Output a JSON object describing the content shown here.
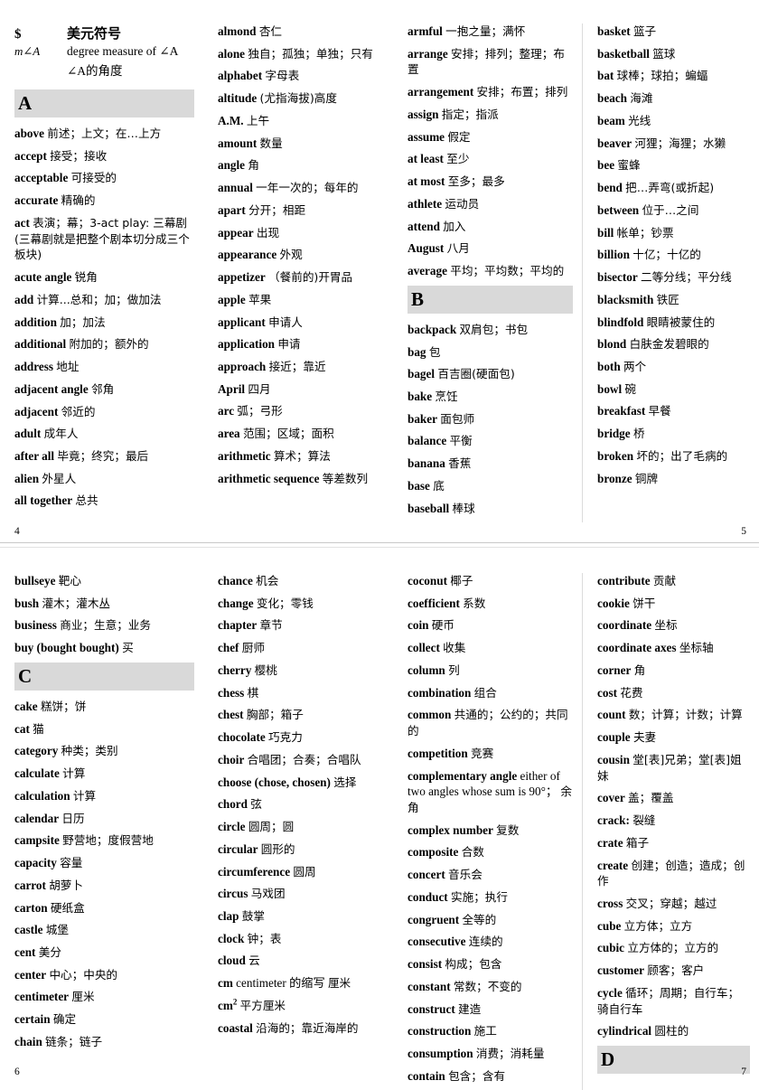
{
  "document": {
    "title": "English-Chinese Math Glossary",
    "header_bar_color": "#d9d9d9",
    "background_color": "#ffffff"
  },
  "symbol_block": {
    "rows": [
      {
        "key": "$",
        "value_cn": "美元符号"
      },
      {
        "key": "m∠A",
        "value_en": "degree measure of ∠A",
        "value_cn": "∠A的角度"
      }
    ]
  },
  "pages": [
    {
      "page_number_left": "4",
      "page_number_right": "5",
      "columns": [
        {
          "name": "column-1",
          "has_symbol_block": true,
          "letter_header": "A",
          "entries": [
            {
              "term": "above",
              "def": "前述；上文；在…上方"
            },
            {
              "term": "accept",
              "def": "接受；接收"
            },
            {
              "term": "acceptable",
              "def": "可接受的"
            },
            {
              "term": "accurate",
              "def": "精确的"
            },
            {
              "term": "act",
              "def": "表演；幕；3-act play: 三幕剧(三幕剧就是把整个剧本切分成三个板块)"
            },
            {
              "term": "acute angle",
              "def": "锐角"
            },
            {
              "term": "add",
              "def": "计算...总和；加；做加法"
            },
            {
              "term": "addition",
              "def": "加；加法"
            },
            {
              "term": "additional",
              "def": "附加的；额外的"
            },
            {
              "term": "address",
              "def": "地址"
            },
            {
              "term": "adjacent angle",
              "def": "邻角"
            },
            {
              "term": "adjacent",
              "def": "邻近的"
            },
            {
              "term": "adult",
              "def": "成年人"
            },
            {
              "term": "after all",
              "def": "毕竟；终究；最后"
            },
            {
              "term": "alien",
              "def": "外星人"
            },
            {
              "term": "all together",
              "def": "总共"
            }
          ]
        },
        {
          "name": "column-2",
          "has_symbol_block": false,
          "letter_header": null,
          "entries": [
            {
              "term": "almond",
              "def": "杏仁"
            },
            {
              "term": "alone",
              "def": "独自；孤独；单独；只有"
            },
            {
              "term": "alphabet",
              "def": "字母表"
            },
            {
              "term": "altitude",
              "def": "(尤指海拔)高度"
            },
            {
              "term": "A.M.",
              "def": "上午"
            },
            {
              "term": "amount",
              "def": "数量"
            },
            {
              "term": "angle",
              "def": "角"
            },
            {
              "term": "annual",
              "def": "一年一次的；每年的"
            },
            {
              "term": "apart",
              "def": "分开；相距"
            },
            {
              "term": "appear",
              "def": "出现"
            },
            {
              "term": "appearance",
              "def": "外观"
            },
            {
              "term": "appetizer",
              "def": "（餐前的)开胃品"
            },
            {
              "term": "apple",
              "def": "苹果"
            },
            {
              "term": "applicant",
              "def": "申请人"
            },
            {
              "term": "application",
              "def": "申请"
            },
            {
              "term": "approach",
              "def": "接近；靠近"
            },
            {
              "term": "April",
              "def": "四月"
            },
            {
              "term": "arc",
              "def": "弧；弓形"
            },
            {
              "term": "area",
              "def": "范围；区域；面积"
            },
            {
              "term": "arithmetic",
              "def": "算术；算法"
            },
            {
              "term": "arithmetic sequence",
              "def": "等差数列"
            }
          ]
        },
        {
          "name": "column-3",
          "has_symbol_block": false,
          "letter_header": null,
          "entries": [
            {
              "term": "armful",
              "def": "一抱之量；满怀"
            },
            {
              "term": "arrange",
              "def": "安排；排列；整理；布置"
            },
            {
              "term": "arrangement",
              "def": "安排；布置；排列"
            },
            {
              "term": "assign",
              "def": "指定；指派"
            },
            {
              "term": "assume",
              "def": "假定"
            },
            {
              "term": "at least",
              "def": "至少"
            },
            {
              "term": "at most",
              "def": "至多；最多"
            },
            {
              "term": "athlete",
              "def": "运动员"
            },
            {
              "term": "attend",
              "def": "加入"
            },
            {
              "term": "August",
              "def": "八月"
            },
            {
              "term": "average",
              "def": "平均；平均数；平均的"
            }
          ],
          "letter_header_mid": "B",
          "entries_after": [
            {
              "term": "backpack",
              "def": "双肩包；书包"
            },
            {
              "term": "bag",
              "def": "包"
            },
            {
              "term": "bagel",
              "def": "百吉圈(硬面包)"
            },
            {
              "term": "bake",
              "def": "烹饪"
            },
            {
              "term": "baker",
              "def": "面包师"
            },
            {
              "term": "balance",
              "def": "平衡"
            },
            {
              "term": "banana",
              "def": "香蕉"
            },
            {
              "term": "base",
              "def": "底"
            },
            {
              "term": "baseball",
              "def": "棒球"
            }
          ]
        },
        {
          "name": "column-4",
          "has_symbol_block": false,
          "letter_header": null,
          "entries": [
            {
              "term": "basket",
              "def": "篮子"
            },
            {
              "term": "basketball",
              "def": "篮球"
            },
            {
              "term": "bat",
              "def": "球棒；球拍；蝙蝠"
            },
            {
              "term": "beach",
              "def": "海滩"
            },
            {
              "term": "beam",
              "def": "光线"
            },
            {
              "term": "beaver",
              "def": "河狸；海狸；水獭"
            },
            {
              "term": "bee",
              "def": "蜜蜂"
            },
            {
              "term": "bend",
              "def": "把…弄弯(或折起)"
            },
            {
              "term": "between",
              "def": "位于…之间"
            },
            {
              "term": "bill",
              "def": "帐单；钞票"
            },
            {
              "term": "billion",
              "def": "十亿；十亿的"
            },
            {
              "term": "bisector",
              "def": "二等分线；平分线"
            },
            {
              "term": "blacksmith",
              "def": "铁匠"
            },
            {
              "term": "blindfold",
              "def": "眼睛被蒙住的"
            },
            {
              "term": "blond",
              "def": "白肤金发碧眼的"
            },
            {
              "term": "both",
              "def": "两个"
            },
            {
              "term": "bowl",
              "def": "碗"
            },
            {
              "term": "breakfast",
              "def": "早餐"
            },
            {
              "term": "bridge",
              "def": "桥"
            },
            {
              "term": "broken",
              "def": "坏的；出了毛病的"
            },
            {
              "term": "bronze",
              "def": "铜牌"
            }
          ]
        }
      ]
    },
    {
      "page_number_left": "6",
      "page_number_right": "7",
      "columns": [
        {
          "name": "column-1",
          "has_symbol_block": false,
          "letter_header": null,
          "entries": [
            {
              "term": "bullseye",
              "def": "靶心"
            },
            {
              "term": "bush",
              "def": "灌木；灌木丛"
            },
            {
              "term": "business",
              "def": "商业；生意；业务"
            },
            {
              "term": "buy (bought bought)",
              "def": "买"
            }
          ],
          "letter_header_mid": "C",
          "entries_after": [
            {
              "term": "cake",
              "def": "糕饼；饼"
            },
            {
              "term": "cat",
              "def": "猫"
            },
            {
              "term": "category",
              "def": "种类；类别"
            },
            {
              "term": "calculate",
              "def": "计算"
            },
            {
              "term": "calculation",
              "def": "计算"
            },
            {
              "term": "calendar",
              "def": "日历"
            },
            {
              "term": "campsite",
              "def": "野营地；度假营地"
            },
            {
              "term": "capacity",
              "def": "容量"
            },
            {
              "term": "carrot",
              "def": "胡萝卜"
            },
            {
              "term": "carton",
              "def": "硬纸盒"
            },
            {
              "term": "castle",
              "def": "城堡"
            },
            {
              "term": "cent",
              "def": "美分"
            },
            {
              "term": "center",
              "def": "中心；中央的"
            },
            {
              "term": "centimeter",
              "def": "厘米"
            },
            {
              "term": "certain",
              "def": "确定"
            },
            {
              "term": "chain",
              "def": "链条；链子"
            }
          ]
        },
        {
          "name": "column-2",
          "has_symbol_block": false,
          "letter_header": null,
          "entries": [
            {
              "term": "chance",
              "def": "机会"
            },
            {
              "term": "change",
              "def": "变化；零钱"
            },
            {
              "term": "chapter",
              "def": "章节"
            },
            {
              "term": "chef",
              "def": "厨师"
            },
            {
              "term": "cherry",
              "def": "樱桃"
            },
            {
              "term": "chess",
              "def": "棋"
            },
            {
              "term": "chest",
              "def": "胸部；箱子"
            },
            {
              "term": "chocolate",
              "def": "巧克力"
            },
            {
              "term": "choir",
              "def": "合唱团；合奏；合唱队"
            },
            {
              "term": "choose (chose, chosen)",
              "def": "选择"
            },
            {
              "term": "chord",
              "def": "弦"
            },
            {
              "term": "circle",
              "def": "圆周；圆"
            },
            {
              "term": "circular",
              "def": "圆形的"
            },
            {
              "term": "circumference",
              "def": "圆周"
            },
            {
              "term": "circus",
              "def": "马戏团"
            },
            {
              "term": "clap",
              "def": "鼓掌"
            },
            {
              "term": "clock",
              "def": "钟；表"
            },
            {
              "term": "cloud",
              "def": "云"
            },
            {
              "term": "cm",
              "def_prefix_plain": "centimeter 的缩写",
              "def": "厘米"
            },
            {
              "term": "cm2",
              "term_sup": "2",
              "term_base": "cm",
              "def": "平方厘米"
            },
            {
              "term": "coastal",
              "def": "沿海的；靠近海岸的"
            }
          ]
        },
        {
          "name": "column-3",
          "has_symbol_block": false,
          "letter_header": null,
          "entries": [
            {
              "term": "coconut",
              "def": "椰子"
            },
            {
              "term": "coefficient",
              "def": "系数"
            },
            {
              "term": "coin",
              "def": "硬币"
            },
            {
              "term": "collect",
              "def": "收集"
            },
            {
              "term": "column",
              "def": "列"
            },
            {
              "term": "combination",
              "def": "组合"
            },
            {
              "term": "common",
              "def": "共通的；公约的；共同的"
            },
            {
              "term": "competition",
              "def": "竞赛"
            },
            {
              "term": "complementary angle",
              "def_en": "either of two angles whose sum is 90°；",
              "def": "余角"
            },
            {
              "term": "complex number",
              "def": "复数"
            },
            {
              "term": "composite",
              "def": "合数"
            },
            {
              "term": "concert",
              "def": "音乐会"
            },
            {
              "term": "conduct",
              "def": "实施；执行"
            },
            {
              "term": "congruent",
              "def": "全等的"
            },
            {
              "term": "consecutive",
              "def": "连续的"
            },
            {
              "term": "consist",
              "def": "构成；包含"
            },
            {
              "term": "constant",
              "def": "常数；不变的"
            },
            {
              "term": "construct",
              "def": "建造"
            },
            {
              "term": "construction",
              "def": "施工"
            },
            {
              "term": "consumption",
              "def": "消费；消耗量"
            },
            {
              "term": "contain",
              "def": "包含；含有"
            }
          ]
        },
        {
          "name": "column-4",
          "has_symbol_block": false,
          "letter_header": null,
          "entries": [
            {
              "term": "contribute",
              "def": "贡献"
            },
            {
              "term": "cookie",
              "def": "饼干"
            },
            {
              "term": "coordinate",
              "def": "坐标"
            },
            {
              "term": "coordinate axes",
              "def": "坐标轴"
            },
            {
              "term": "corner",
              "def": "角"
            },
            {
              "term": "cost",
              "def": "花费"
            },
            {
              "term": "count",
              "def": "数；计算；计数；计算"
            },
            {
              "term": "couple",
              "def": "夫妻"
            },
            {
              "term": "cousin",
              "def": "堂[表]兄弟；堂[表]姐妹"
            },
            {
              "term": "cover",
              "def": "盖；覆盖"
            },
            {
              "term": "crack:",
              "def": "裂缝"
            },
            {
              "term": "crate",
              "def": "箱子"
            },
            {
              "term": "create",
              "def": "创建；创造；造成；创作"
            },
            {
              "term": "cross",
              "def": "交叉；穿越；越过"
            },
            {
              "term": "cube",
              "def": "立方体；立方"
            },
            {
              "term": "cubic",
              "def": "立方体的；立方的"
            },
            {
              "term": "customer",
              "def": "顾客；客户"
            },
            {
              "term": "cycle",
              "def": "循环；周期；自行车；骑自行车"
            },
            {
              "term": "cylindrical",
              "def": "圆柱的"
            }
          ],
          "letter_header_mid": "D",
          "entries_after": []
        }
      ]
    }
  ]
}
